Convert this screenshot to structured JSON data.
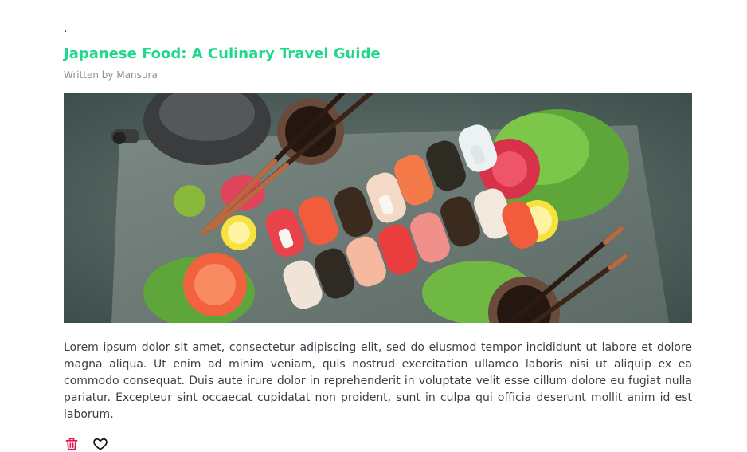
{
  "post": {
    "marker": ".",
    "title": "Japanese Food: A Culinary Travel Guide",
    "author_line": "Written by Mansura",
    "body": "Lorem ipsum dolor sit amet, consectetur adipiscing elit, sed do eiusmod tempor incididunt ut labore et dolore magna aliqua. Ut enim ad minim veniam, quis nostrud exercitation ullamco laboris nisi ut aliquip ex ea commodo consequat. Duis aute irure dolor in reprehenderit in voluptate velit esse cillum dolore eu fugiat nulla pariatur. Excepteur sint occaecat cupidatat non proident, sunt in culpa qui officia deserunt mollit anim id est laborum."
  },
  "icons": {
    "delete": "trash-icon",
    "like": "heart-icon"
  },
  "colors": {
    "title": "#1fd88a",
    "author": "#8a8f99",
    "delete": "#e5134f",
    "like": "#111111"
  }
}
